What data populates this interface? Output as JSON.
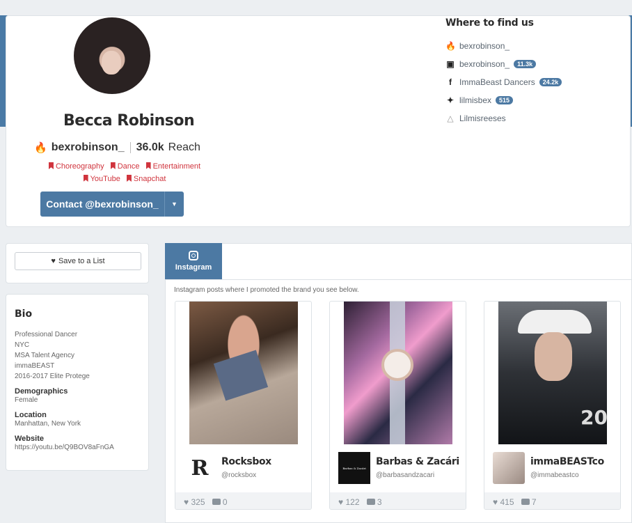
{
  "profile": {
    "name": "Becca Robinson",
    "handle": "bexrobinson_",
    "reach_value": "36.0k",
    "reach_label": "Reach",
    "tags_row1": [
      "Choreography",
      "Dance",
      "Entertainment"
    ],
    "tags_row2": [
      "YouTube",
      "Snapchat"
    ],
    "contact_label": "Contact @bexrobinson_"
  },
  "where_to_find": {
    "title": "Where to find us",
    "items": [
      {
        "icon": "flame-icon",
        "label": "bexrobinson_",
        "badge": ""
      },
      {
        "icon": "instagram-icon",
        "label": "bexrobinson_",
        "badge": "11.3k"
      },
      {
        "icon": "facebook-icon",
        "label": "ImmaBeast Dancers",
        "badge": "24.2k"
      },
      {
        "icon": "twitter-icon",
        "label": "lilmisbex",
        "badge": "515"
      },
      {
        "icon": "snapchat-icon",
        "label": "Lilmisreeses",
        "badge": ""
      }
    ]
  },
  "sidebar": {
    "save_label": "Save to a List",
    "bio_title": "Bio",
    "bio_lines": [
      "Professional Dancer",
      "NYC",
      "MSA Talent Agency",
      "immaBEAST",
      "2016-2017 Elite Protege"
    ],
    "demographics_label": "Demographics",
    "demographics_value": "Female",
    "location_label": "Location",
    "location_value": "Manhattan, New York",
    "website_label": "Website",
    "website_value": "https://youtu.be/Q9BOV8aFnGA"
  },
  "content": {
    "tab_label": "Instagram",
    "description": "Instagram posts where I promoted the brand you see below.",
    "posts": [
      {
        "brand": "Rocksbox",
        "handle": "@rocksbox",
        "likes": "325",
        "comments": "0"
      },
      {
        "brand": "Barbas & Zacári",
        "handle": "@barbasandzacari",
        "likes": "122",
        "comments": "3"
      },
      {
        "brand": "immaBEASTco",
        "handle": "@immabeastco",
        "likes": "415",
        "comments": "7"
      }
    ]
  },
  "colors": {
    "accent": "#4c79a3",
    "tag": "#d0343d",
    "flame": "#f0a020"
  }
}
